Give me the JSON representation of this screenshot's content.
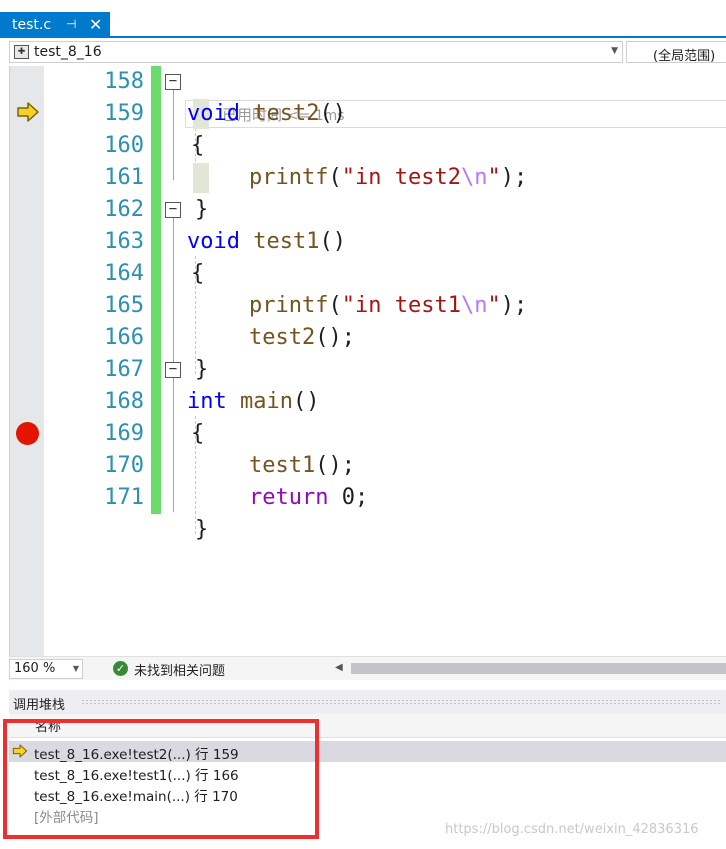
{
  "tab": {
    "label": "test.c",
    "pin_glyph": "⊣",
    "close_glyph": "✕"
  },
  "navbar": {
    "project": "test_8_16",
    "scope": "(全局范围)"
  },
  "editor": {
    "line_numbers": [
      "158",
      "159",
      "160",
      "161",
      "162",
      "163",
      "164",
      "165",
      "166",
      "167",
      "168",
      "169",
      "170",
      "171"
    ],
    "code": {
      "l158": {
        "kw": "void",
        "fn": "test2",
        "rest": "()"
      },
      "l159": {
        "brace": "{",
        "perf_label": "已用时间",
        "perf_value": "<= 1ms"
      },
      "l160": {
        "fn": "printf",
        "open": "(",
        "str1": "\"in test2",
        "esc": "\\n",
        "str2": "\"",
        "close": ");"
      },
      "l161": {
        "brace": "}"
      },
      "l162": {
        "kw": "void",
        "fn": "test1",
        "rest": "()"
      },
      "l163": {
        "brace": "{"
      },
      "l164": {
        "fn": "printf",
        "open": "(",
        "str1": "\"in test1",
        "esc": "\\n",
        "str2": "\"",
        "close": ");"
      },
      "l165": {
        "fn": "test2",
        "rest": "();"
      },
      "l166": {
        "brace": "}"
      },
      "l167": {
        "kw": "int",
        "fn": "main",
        "rest": "()"
      },
      "l168": {
        "brace": "{"
      },
      "l169": {
        "fn": "test1",
        "rest": "();"
      },
      "l170": {
        "kw": "return",
        "rest": " 0;"
      },
      "l171": {
        "brace": "}"
      }
    },
    "collapse_glyph": "−",
    "execution_line": "159",
    "breakpoint_line": "169"
  },
  "status": {
    "zoom": "160 %",
    "issues": "未找到相关问题",
    "check_glyph": "✓"
  },
  "call_stack": {
    "title": "调用堆栈",
    "column_name": "名称",
    "frames": [
      "test_8_16.exe!test2(...) 行 159",
      "test_8_16.exe!test1(...) 行 166",
      "test_8_16.exe!main(...) 行 170",
      "[外部代码]"
    ]
  },
  "watermark": "https://blog.csdn.net/weixin_42836316",
  "colors": {
    "accent": "#007acc",
    "breakpoint": "#e51400",
    "change_bar": "#6bdc6b",
    "highlight_frame": "#ef2f2f"
  },
  "icons": [
    "pin-icon",
    "close-icon",
    "project-icon",
    "dropdown-arrow-icon",
    "collapse-icon",
    "execution-arrow-icon",
    "breakpoint-icon",
    "check-icon"
  ]
}
